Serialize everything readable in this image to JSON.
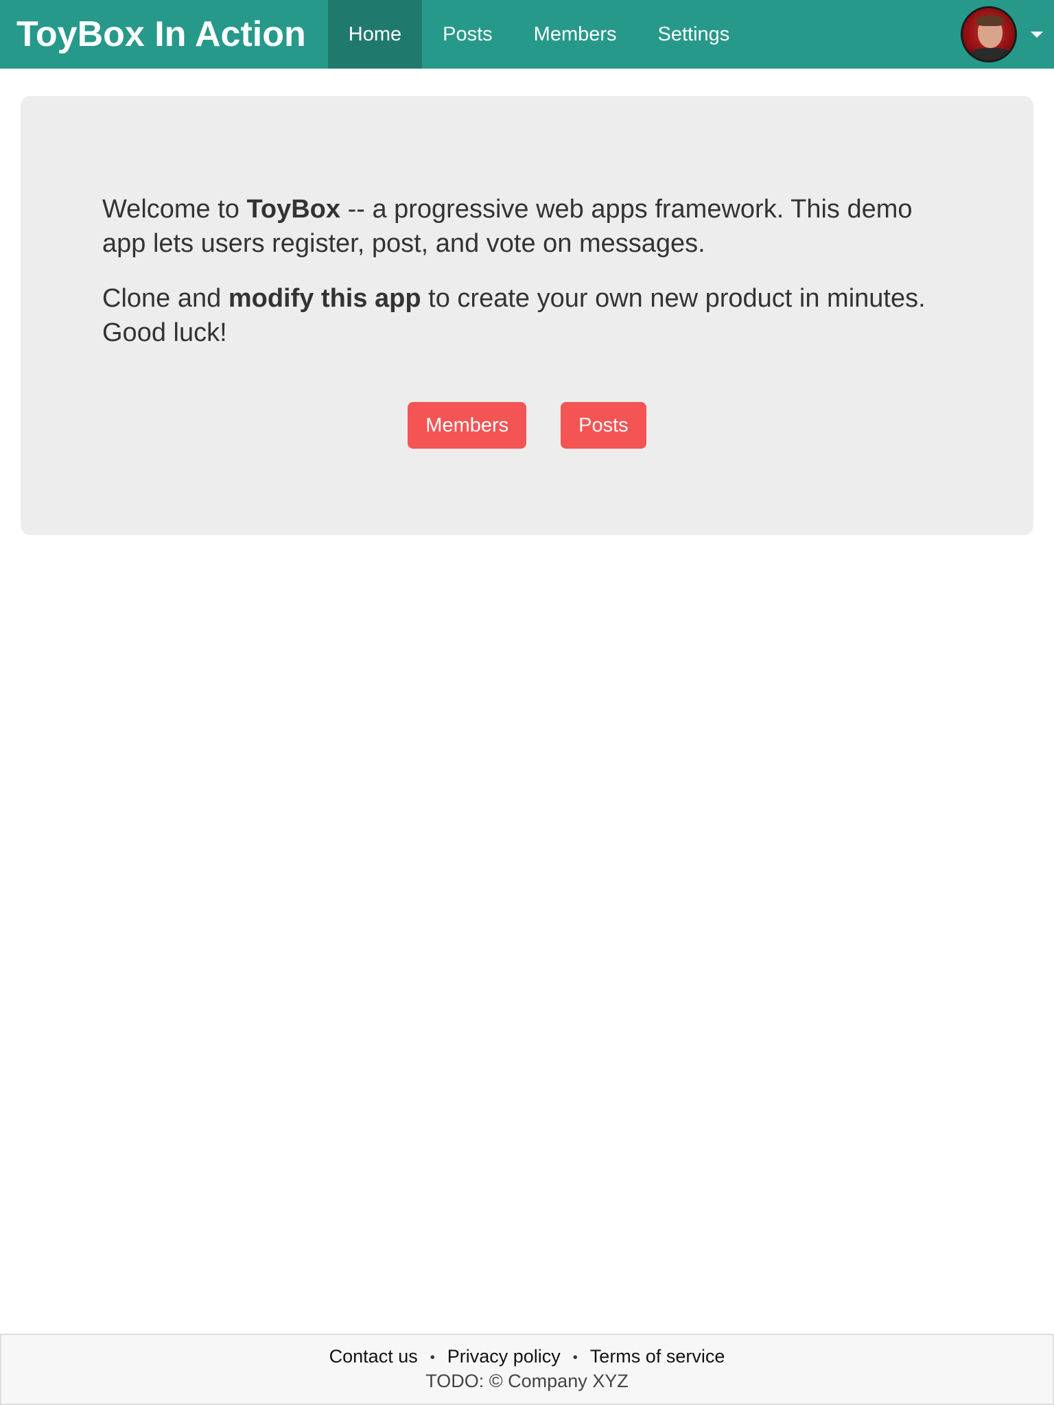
{
  "navbar": {
    "brand": "ToyBox In Action",
    "links": [
      {
        "label": "Home",
        "active": true
      },
      {
        "label": "Posts",
        "active": false
      },
      {
        "label": "Members",
        "active": false
      },
      {
        "label": "Settings",
        "active": false
      }
    ],
    "avatar_icon": "user-avatar",
    "menu_icon": "caret-down-icon"
  },
  "hero": {
    "p1_pre": "Welcome to ",
    "p1_bold": "ToyBox",
    "p1_post": " -- a progressive web apps framework. This demo app lets users register, post, and vote on messages.",
    "p2_pre": "Clone and ",
    "p2_bold": "modify this app",
    "p2_post": " to create your own new product in minutes. Good luck!",
    "buttons": [
      {
        "label": "Members"
      },
      {
        "label": "Posts"
      }
    ]
  },
  "footer": {
    "links": [
      {
        "label": "Contact us"
      },
      {
        "label": "Privacy policy"
      },
      {
        "label": "Terms of service"
      }
    ],
    "separator": "•",
    "copyright": "TODO: © Company XYZ"
  },
  "colors": {
    "navbar": "#26998a",
    "navbar_active": "#1f7a6d",
    "hero_bg": "#ededee",
    "button": "#f55454",
    "text": "#333333",
    "footer_bg": "#f7f7f7"
  }
}
